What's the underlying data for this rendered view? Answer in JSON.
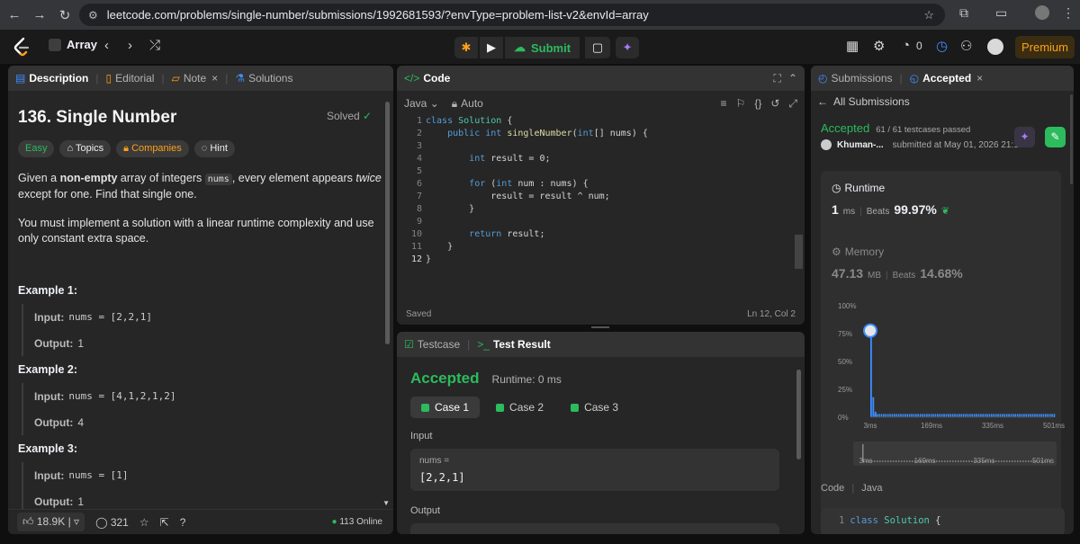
{
  "browser": {
    "url": "leetcode.com/problems/single-number/submissions/1992681593/?envType=problem-list-v2&envId=array"
  },
  "topbar": {
    "problem_list": "Array",
    "submit_label": "Submit",
    "fire_count": "0",
    "premium_label": "Premium"
  },
  "description_panel": {
    "tabs": [
      "Description",
      "Editorial",
      "Note",
      "Solutions"
    ],
    "title": "136. Single Number",
    "solved_label": "Solved",
    "tags": [
      "Easy",
      "Topics",
      "Companies",
      "Hint"
    ],
    "para1_a": "Given a ",
    "para1_b": "non-empty",
    "para1_c": " array of integers ",
    "para1_code": "nums",
    "para1_d": ", every element appears ",
    "para1_e": "twice",
    "para1_f": " except for one. Find that single one.",
    "para2": "You must implement a solution with a linear runtime complexity and use only constant extra space.",
    "examples": [
      {
        "title": "Example 1:",
        "input_label": "Input:",
        "input": "nums = [2,2,1]",
        "output_label": "Output:",
        "output": "1"
      },
      {
        "title": "Example 2:",
        "input_label": "Input:",
        "input": "nums = [4,1,2,1,2]",
        "output_label": "Output:",
        "output": "4"
      },
      {
        "title": "Example 3:",
        "input_label": "Input:",
        "input": "nums = [1]",
        "output_label": "Output:",
        "output": "1"
      }
    ],
    "likes": "18.9K",
    "comments": "321",
    "online": "113 Online"
  },
  "code_panel": {
    "tab": "Code",
    "language": "Java",
    "mode": "Auto",
    "lines": [
      {
        "n": "1",
        "t": "class Solution {"
      },
      {
        "n": "2",
        "t": "    public int singleNumber(int[] nums) {"
      },
      {
        "n": "3",
        "t": ""
      },
      {
        "n": "4",
        "t": "        int result = 0;"
      },
      {
        "n": "5",
        "t": ""
      },
      {
        "n": "6",
        "t": "        for (int num : nums) {"
      },
      {
        "n": "7",
        "t": "            result = result ^ num;"
      },
      {
        "n": "8",
        "t": "        }"
      },
      {
        "n": "9",
        "t": ""
      },
      {
        "n": "10",
        "t": "        return result;"
      },
      {
        "n": "11",
        "t": "    }"
      },
      {
        "n": "12",
        "t": "}"
      }
    ],
    "status": "Saved",
    "cursor": "Ln 12, Col 2"
  },
  "result_panel": {
    "tabs": [
      "Testcase",
      "Test Result"
    ],
    "verdict": "Accepted",
    "runtime": "Runtime: 0 ms",
    "cases": [
      "Case 1",
      "Case 2",
      "Case 3"
    ],
    "input_label": "Input",
    "var_name": "nums =",
    "var_value": "[2,2,1]",
    "output_label": "Output"
  },
  "submission_panel": {
    "tabs": [
      "Submissions",
      "Accepted"
    ],
    "back_label": "All Submissions",
    "verdict": "Accepted",
    "passed": "61 / 61 testcases passed",
    "user": "Khuman-...",
    "submitted": "submitted at May 01, 2026 21:12",
    "runtime_title": "Runtime",
    "runtime_value": "1",
    "runtime_unit": "ms",
    "runtime_beats_label": "Beats",
    "runtime_beats": "99.97%",
    "memory_title": "Memory",
    "memory_value": "47.13",
    "memory_unit": "MB",
    "memory_beats_label": "Beats",
    "memory_beats": "14.68%",
    "code_label": "Code",
    "code_lang": "Java",
    "code_first_line": "class Solution {"
  },
  "chart_data": {
    "type": "bar",
    "y_ticks": [
      "100%",
      "75%",
      "50%",
      "25%",
      "0%"
    ],
    "x_ticks": [
      "3ms",
      "169ms",
      "335ms",
      "501ms"
    ],
    "minimap_ticks": [
      "3ms",
      "169ms",
      "335ms",
      "501ms"
    ],
    "ylim": [
      0,
      100
    ],
    "xlim": [
      3,
      501
    ],
    "bars_x_ms": [
      3,
      6,
      9
    ],
    "bars_pct": [
      76,
      18,
      5
    ],
    "tail_pct": 0.5
  },
  "colors": {
    "accent_green": "#2cbb5d",
    "accent_orange": "#ffa116",
    "chart_blue": "#3d8eff"
  }
}
